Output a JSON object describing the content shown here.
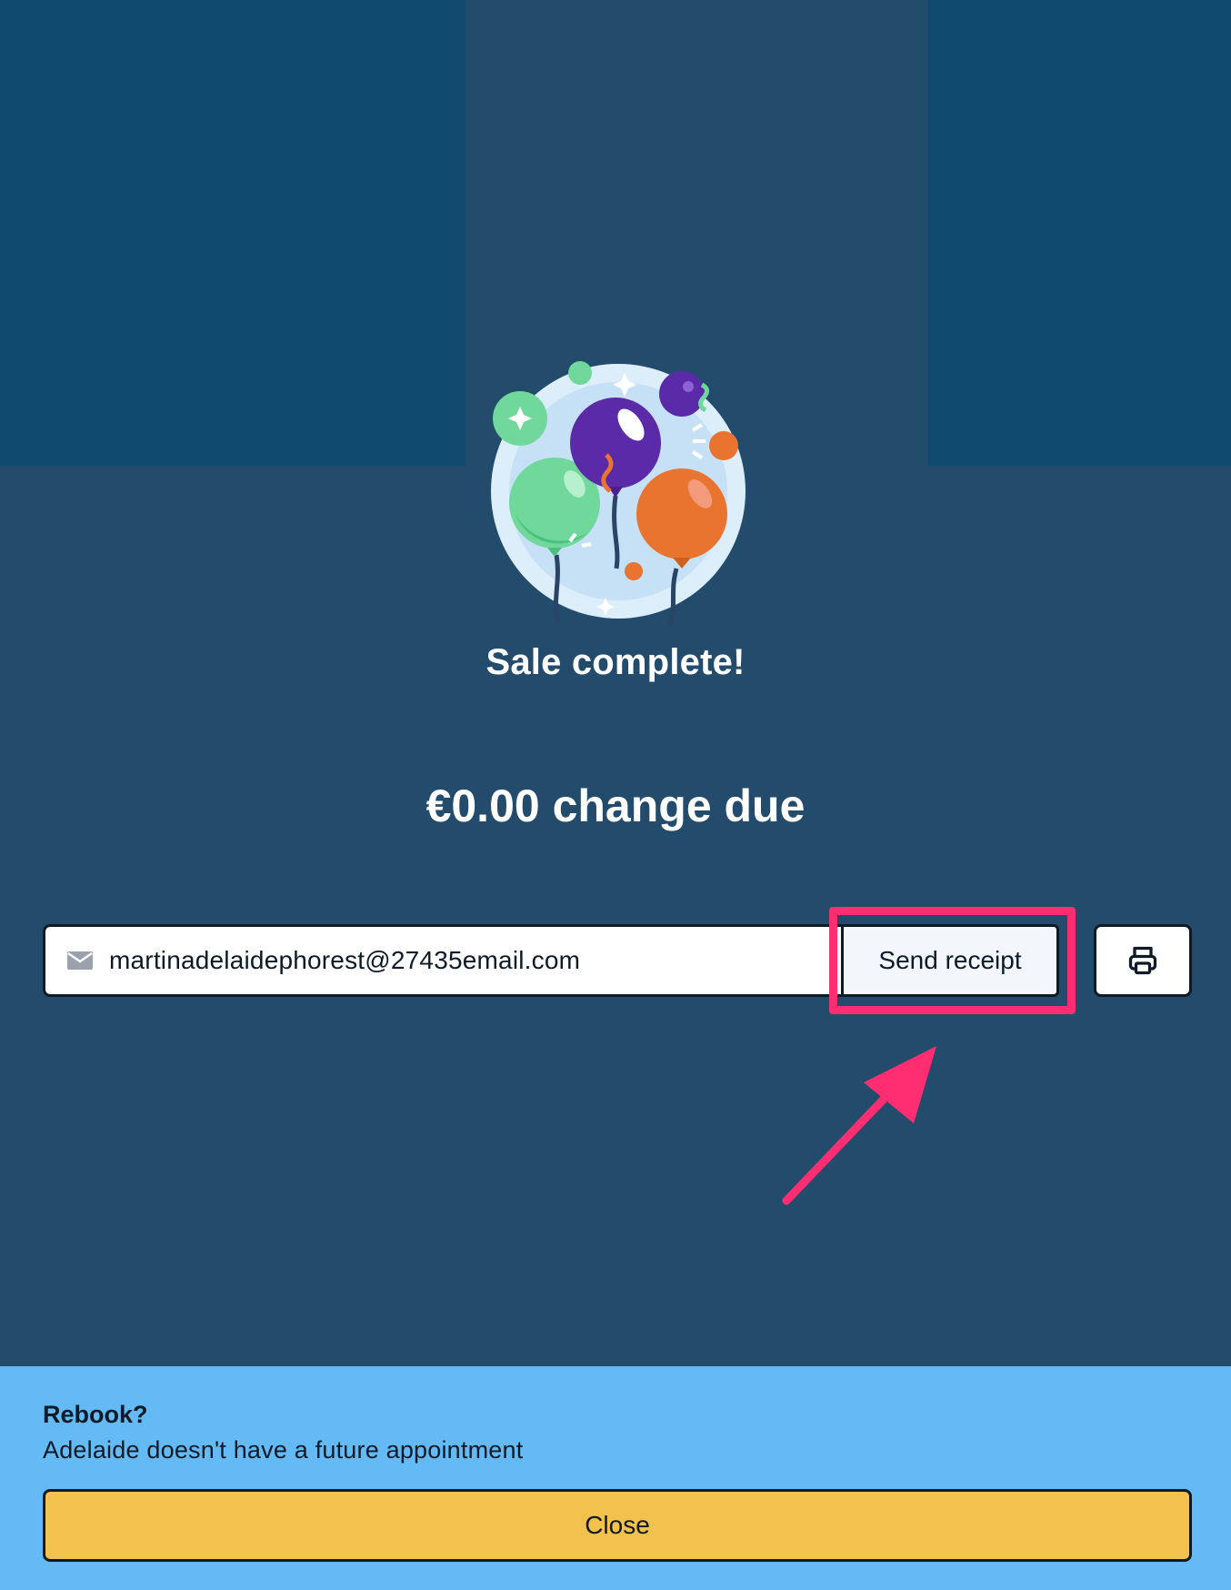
{
  "success": {
    "title": "Sale complete!",
    "change_due": "€0.00 change due",
    "illustration_icon": "balloons-icon"
  },
  "receipt": {
    "email_value": "martinadelaidephorest@27435email.com",
    "send_label": "Send receipt",
    "mail_icon": "mail-icon",
    "print_icon": "printer-icon"
  },
  "rebook": {
    "title": "Rebook?",
    "message": "Adelaide doesn't have a future appointment",
    "close_label": "Close"
  },
  "colors": {
    "background": "#234b6b",
    "background_blocks": "#0f4a6e",
    "rebook_panel": "#64baf5",
    "close_button": "#f2c14e",
    "highlight": "#ff2e72"
  }
}
